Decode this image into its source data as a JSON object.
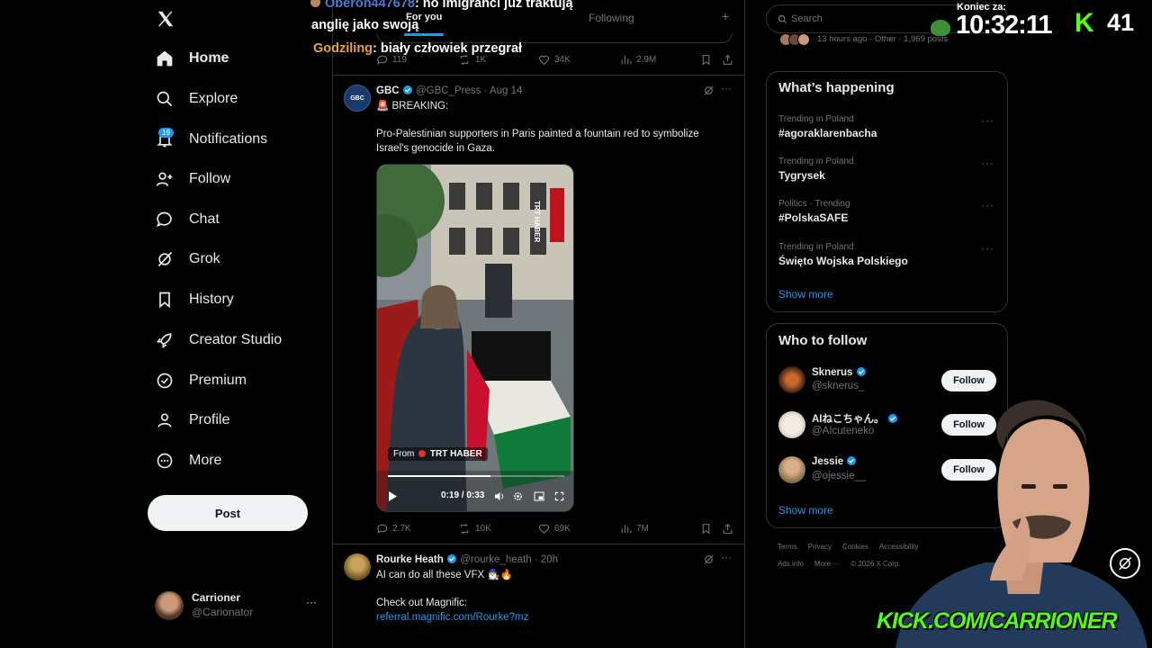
{
  "nav": {
    "items": [
      {
        "label": "Home",
        "icon": "home-icon"
      },
      {
        "label": "Explore",
        "icon": "search-icon"
      },
      {
        "label": "Notifications",
        "icon": "bell-icon"
      },
      {
        "label": "Follow",
        "icon": "person-plus-icon"
      },
      {
        "label": "Chat",
        "icon": "chat-bubble-icon"
      },
      {
        "label": "Grok",
        "icon": "grok-icon"
      },
      {
        "label": "History",
        "icon": "bookmark-icon"
      },
      {
        "label": "Creator Studio",
        "icon": "rocket-icon"
      },
      {
        "label": "Premium",
        "icon": "verified-icon"
      },
      {
        "label": "Profile",
        "icon": "person-icon"
      },
      {
        "label": "More",
        "icon": "more-circle-icon"
      }
    ],
    "notifications_badge": "19",
    "post_label": "Post",
    "account": {
      "name": "Carrioner",
      "handle": "@Carionator",
      "more": "···"
    }
  },
  "tabs": {
    "for_you": "For you",
    "following": "Following",
    "add": "+"
  },
  "prev_tweet_actions": {
    "replies": "119",
    "reposts": "1K",
    "likes": "34K",
    "views": "2.9M"
  },
  "tweet1": {
    "avatar_text": "GBC",
    "name": "GBC",
    "handle": "@GBC_Press",
    "sep": "·",
    "date": "Aug 14",
    "line1": "🚨 BREAKING:",
    "line2": "Pro-Palestinian supporters in Paris painted a fountain red to symbolize",
    "line3": "Israel's genocide in Gaza.",
    "video": {
      "source_prefix": "From",
      "source": "TRT HABER",
      "vertical_logo": "TRT HABER",
      "time": "0:19 / 0:33",
      "progress": 0.58
    },
    "actions": {
      "replies": "2.7K",
      "reposts": "10K",
      "likes": "69K",
      "views": "7M"
    }
  },
  "tweet2": {
    "name": "Rourke Heath",
    "handle": "@rourke_heath",
    "sep": "·",
    "date": "20h",
    "line1": "AI can do all these VFX 🧙‍♂️🔥",
    "line2": "Check out Magnific:",
    "link": "referral.magnific.com/Rourke?mz"
  },
  "search": {
    "placeholder": "Search"
  },
  "top_snippet": "13 hours ago · Other · 1,969 posts",
  "trending": {
    "title": "What’s happening",
    "items": [
      {
        "category": "Trending in Poland",
        "name": "#agoraklarenbacha"
      },
      {
        "category": "Trending in Poland",
        "name": "Tygrysek"
      },
      {
        "category": "Politics · Trending",
        "name": "#PolskaSAFE"
      },
      {
        "category": "Trending in Poland",
        "name": "Święto Wojska Polskiego"
      }
    ],
    "show_more": "Show more"
  },
  "who_to_follow": {
    "title": "Who to follow",
    "items": [
      {
        "name": "Sknerus",
        "handle": "@sknerus_",
        "button": "Follow"
      },
      {
        "name": "AIねこちゃん。",
        "handle": "@AIcuteneko",
        "button": "Follow"
      },
      {
        "name": "Jessie",
        "handle": "@ojessie__",
        "button": "Follow"
      }
    ],
    "show_more": "Show more"
  },
  "footer": {
    "row1": [
      "Terms",
      "Privacy",
      "Cookies",
      "Accessibility"
    ],
    "row2": [
      "Ads info",
      "More ···",
      "© 2026 X Corp."
    ]
  },
  "overlay": {
    "chat1_user": "Oberon447678",
    "chat1_text": ": no imigranci już traktują",
    "chat1_text2": "anglię jako swoją",
    "chat2_user": "Godziling",
    "chat2_text": ": biały człowiek przegrał",
    "timer_label": "Koniec za:",
    "timer": "10:32:11",
    "kick_letter": "K",
    "viewers": "41",
    "brand": "KICK.COM/CARRIONER"
  },
  "colors": {
    "accent": "#1d9bf0",
    "kick_green": "#53fc18",
    "username_blue": "#4a7bd6",
    "username_orange": "#e8a33d"
  }
}
